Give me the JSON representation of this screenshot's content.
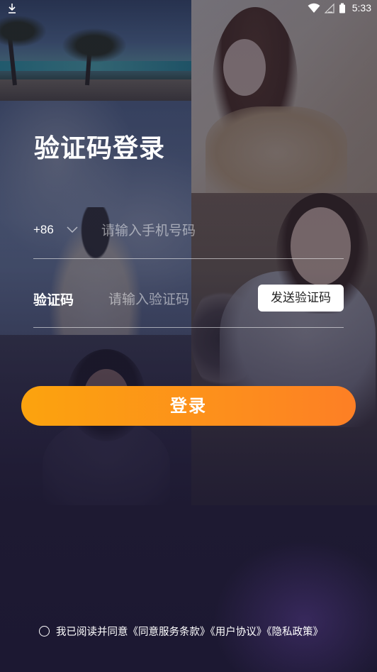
{
  "status_bar": {
    "time": "5:33"
  },
  "login": {
    "title": "验证码登录",
    "country_code": "+86",
    "phone_placeholder": "请输入手机号码",
    "code_label": "验证码",
    "code_placeholder": "请输入验证码",
    "send_code_label": "发送验证码",
    "login_label": "登录"
  },
  "agreement": {
    "prefix": "我已阅读并同意",
    "terms_link": "《同意服务条款》",
    "user_agreement_link": "《用户协议》",
    "privacy_link": "《隐私政策》",
    "checked": false
  },
  "icons": {
    "download": "download-icon",
    "wifi": "wifi-icon",
    "signal": "signal-icon",
    "battery": "battery-icon",
    "chevron": "chevron-down-icon"
  },
  "colors": {
    "button_gradient_start": "#fca30e",
    "button_gradient_end": "#fd7f25",
    "send_code_bg": "#ffffff"
  }
}
